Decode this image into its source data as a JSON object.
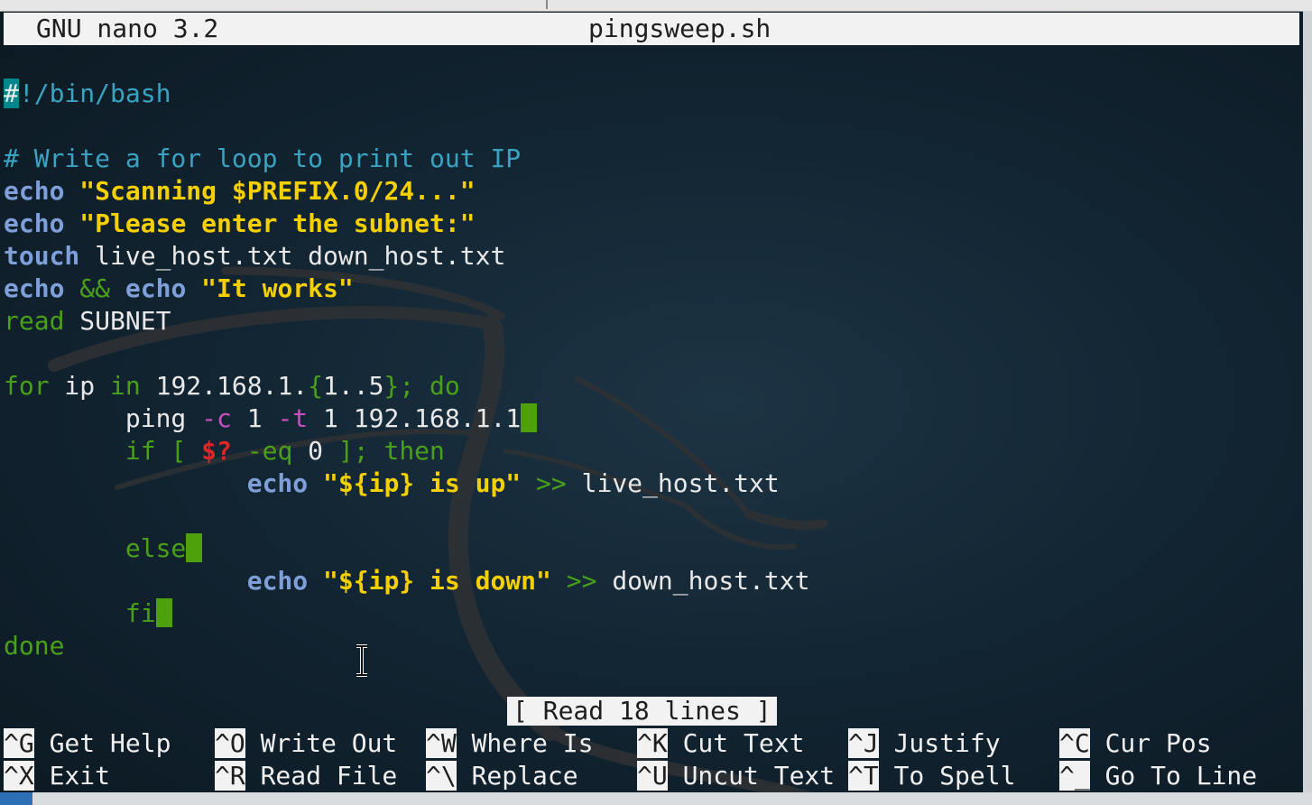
{
  "titlebar": {
    "app_version": "GNU nano 3.2",
    "filename": "pingsweep.sh"
  },
  "code": {
    "l1_hash": "#",
    "l1_rest": "!/bin/bash",
    "l3": "# Write a for loop to print out IP",
    "l4_kw": "echo",
    "l4_str": "\"Scanning $PREFIX.0/24...\"",
    "l5_kw": "echo",
    "l5_str": "\"Please enter the subnet:\"",
    "l6_kw": "touch",
    "l6_rest": " live_host.txt down_host.txt",
    "l7_kw1": "echo",
    "l7_op": "&&",
    "l7_kw2": "echo",
    "l7_str": "\"It works\"",
    "l8_kw": "read",
    "l8_rest": " SUBNET",
    "l10_for": "for",
    "l10_ip": " ip ",
    "l10_in": "in",
    "l10_range": " 192.168.1.",
    "l10_brace_open": "{",
    "l10_mid": "1..5",
    "l10_brace_close": "}",
    "l10_do": "; do",
    "l11_ping": "ping ",
    "l11_c": "-c",
    "l11_one": " 1 ",
    "l11_t": "-t",
    "l11_addr": " 1 192.168.1.1",
    "l12_if": "if [ ",
    "l12_var": "$?",
    "l12_eq": " -eq ",
    "l12_zero": "0",
    "l12_then": " ]; then",
    "l13_kw": "echo",
    "l13_str": "\"${ip} is up\"",
    "l13_redir": ">>",
    "l13_file": " live_host.txt",
    "l15_else": "else",
    "l16_kw": "echo",
    "l16_str": "\"${ip} is down\"",
    "l16_redir": ">>",
    "l16_file": " down_host.txt",
    "l17_fi": "fi",
    "l18_done": "done"
  },
  "status_message": "[ Read 18 lines ]",
  "shortcuts": [
    {
      "key": "^G",
      "label": " Get Help"
    },
    {
      "key": "^O",
      "label": " Write Out"
    },
    {
      "key": "^W",
      "label": " Where Is"
    },
    {
      "key": "^K",
      "label": " Cut Text"
    },
    {
      "key": "^J",
      "label": " Justify"
    },
    {
      "key": "^C",
      "label": " Cur Pos"
    },
    {
      "key": "^X",
      "label": " Exit"
    },
    {
      "key": "^R",
      "label": " Read File"
    },
    {
      "key": "^\\",
      "label": " Replace"
    },
    {
      "key": "^U",
      "label": " Uncut Text"
    },
    {
      "key": "^T",
      "label": " To Spell"
    },
    {
      "key": "^_",
      "label": " Go To Line"
    }
  ],
  "colors": {
    "background": "#132634",
    "keyword_echo": "#7f9fd9",
    "string": "#f5d000",
    "comment": "#3aa3c2",
    "control": "#4aa01a",
    "option": "#c84fc0",
    "special_var": "#e02727",
    "cursor_block": "#4ea10a"
  }
}
